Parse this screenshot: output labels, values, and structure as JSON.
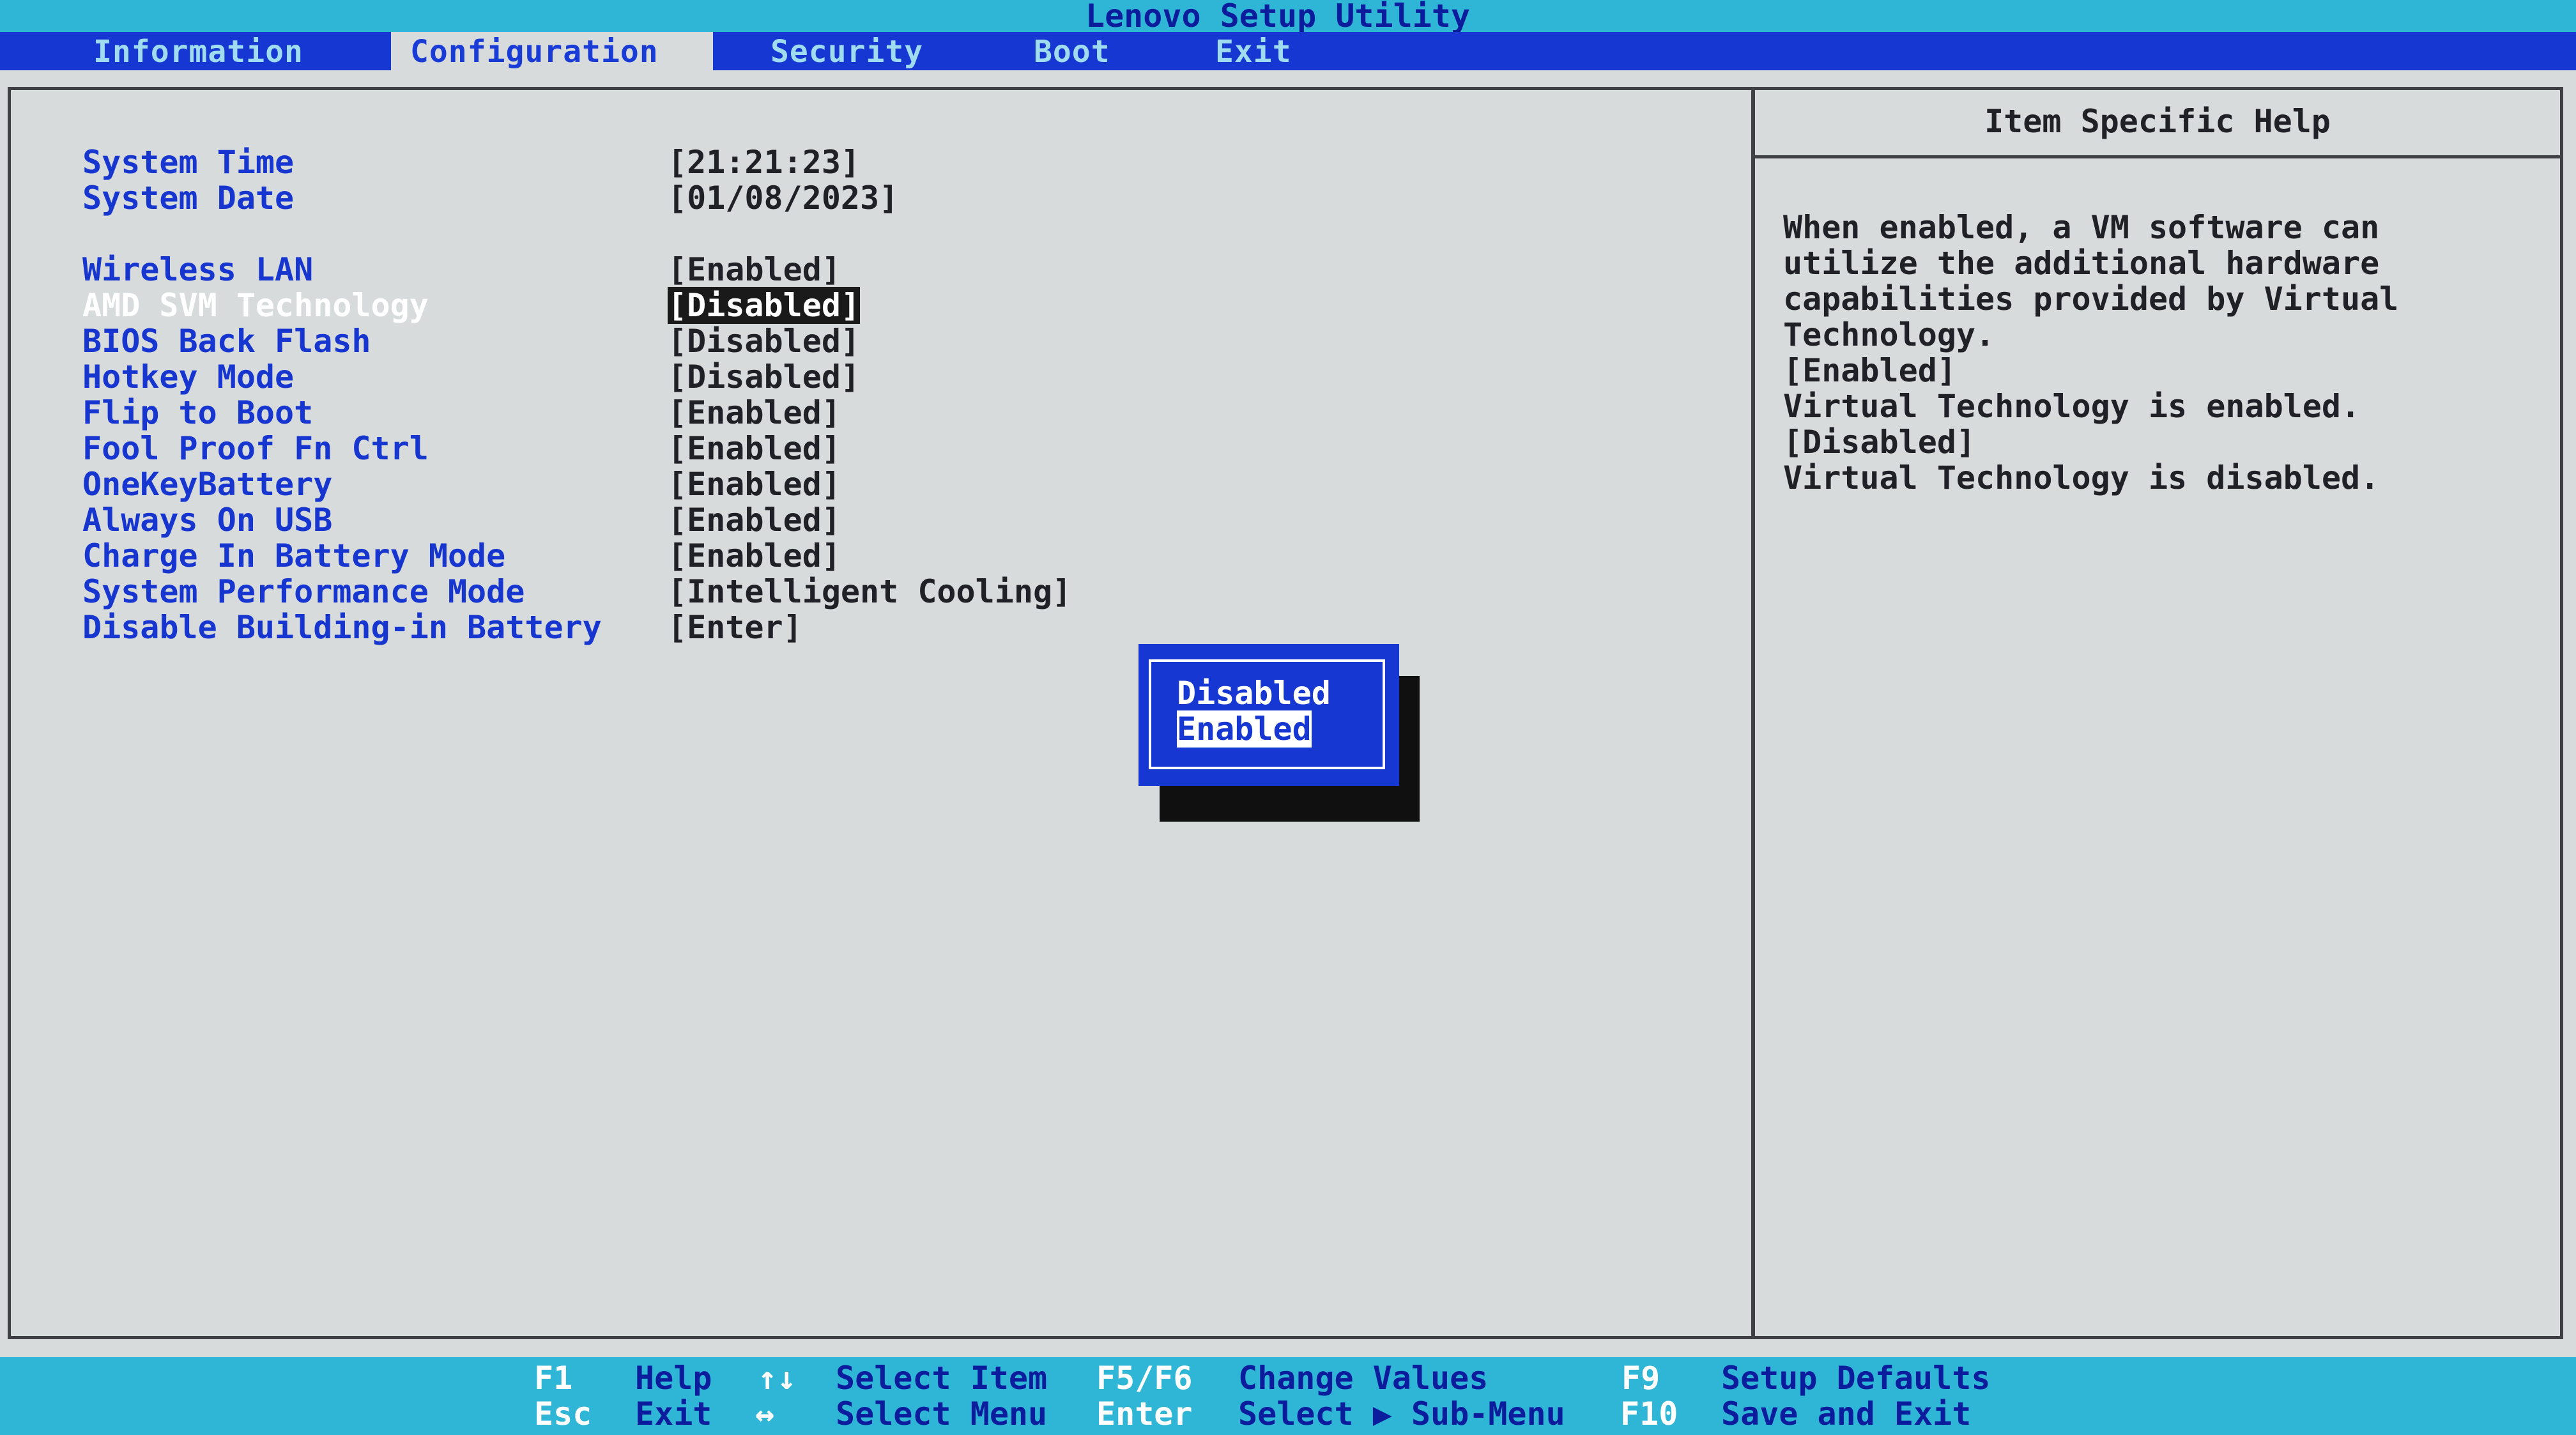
{
  "title": "Lenovo Setup Utility",
  "menu": {
    "information": "Information",
    "configuration": "Configuration",
    "security": "Security",
    "boot": "Boot",
    "exit": "Exit"
  },
  "settings": [
    {
      "label": "System Time",
      "value": "[21:21:23]"
    },
    {
      "label": "System Date",
      "value": "[01/08/2023]"
    },
    {
      "label": "Wireless LAN",
      "value": "[Enabled]"
    },
    {
      "label": "AMD SVM Technology",
      "value_prefix": "[",
      "value": "Disabled",
      "value_suffix": "]"
    },
    {
      "label": "BIOS Back Flash",
      "value": "[Disabled]"
    },
    {
      "label": "Hotkey Mode",
      "value": "[Disabled]"
    },
    {
      "label": "Flip to Boot",
      "value": "[Enabled]"
    },
    {
      "label": "Fool Proof Fn Ctrl",
      "value": "[Enabled]"
    },
    {
      "label": "OneKeyBattery",
      "value": "[Enabled]"
    },
    {
      "label": "Always On USB",
      "value": "[Enabled]"
    },
    {
      "label": "Charge In Battery Mode",
      "value": "[Enabled]"
    },
    {
      "label": "System Performance Mode",
      "value": "[Intelligent Cooling]"
    },
    {
      "label": "Disable Building-in Battery",
      "value": "[Enter]"
    }
  ],
  "help": {
    "title": "Item Specific Help",
    "lines": [
      "When enabled, a VM software can",
      "utilize the additional hardware",
      "capabilities provided by Virtual",
      "Technology.",
      "[Enabled]",
      "Virtual Technology is enabled.",
      "[Disabled]",
      "Virtual Technology is disabled."
    ]
  },
  "popup": {
    "options": [
      "Disabled",
      "Enabled"
    ],
    "selected": "Enabled"
  },
  "footer": {
    "f1": "F1",
    "f1_desc": "Help",
    "esc": "Esc",
    "esc_desc": "Exit",
    "updown": "↑↓",
    "updown_desc": "Select Item",
    "leftright": "↔",
    "leftright_desc": "Select Menu",
    "f5f6": "F5/F6",
    "f5f6_desc": "Change Values",
    "enter": "Enter",
    "enter_desc": "Select ▶ Sub-Menu",
    "f9": "F9",
    "f9_desc": "Setup Defaults",
    "f10": "F10",
    "f10_desc": "Save and Exit"
  },
  "colors": {
    "menu_bar": "#1737d2",
    "title_bar": "#2fb6d6",
    "background": "#d8dbdc",
    "label_blue": "#1636cf"
  }
}
